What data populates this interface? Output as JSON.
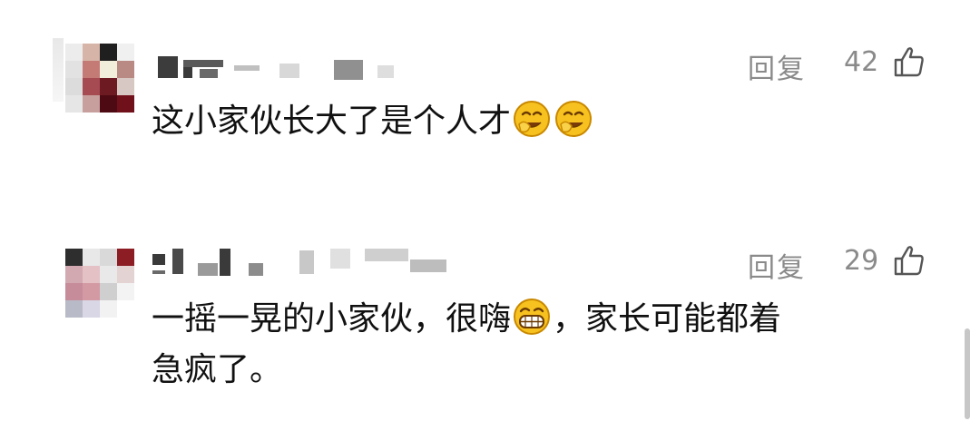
{
  "comments": [
    {
      "reply_label": "回复",
      "likes": "42",
      "text_before_emoji": "这小家伙长大了是个人才",
      "emojis": [
        "grin-face-icon",
        "grin-face-icon"
      ]
    },
    {
      "reply_label": "回复",
      "likes": "29",
      "text_line1_a": "一摇一晃的小家伙，很嗨",
      "text_line1_b": "，家长可能都着",
      "text_line2": "急疯了。",
      "emojis": [
        "big-grin-face-icon"
      ]
    }
  ],
  "colors": {
    "meta_gray": "#8a8a8a",
    "text": "#111111",
    "emoji_yellow": "#f7c21f"
  }
}
